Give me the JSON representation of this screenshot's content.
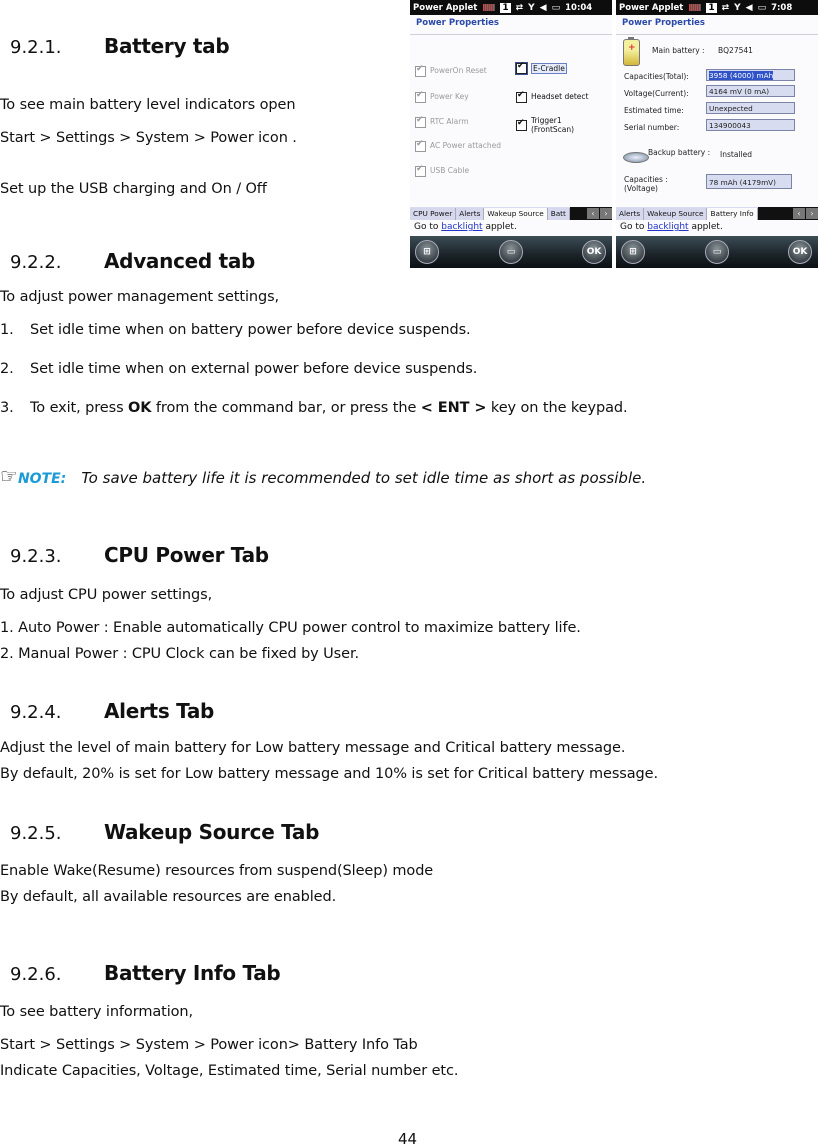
{
  "page_number": "44",
  "sections": [
    {
      "number": "9.2.1.",
      "title": "Battery tab",
      "lines": [
        "To see main battery level indicators open",
        "Start > Settings > System > Power icon .",
        "Set up the USB charging and On / Off"
      ]
    },
    {
      "number": "9.2.2.",
      "title": "Advanced tab",
      "intro": "To adjust power management settings,",
      "items": [
        "1.",
        "Set idle time when on battery power before device suspends.",
        "2.",
        "Set idle time when on external power before device suspends.",
        "3."
      ],
      "step3": {
        "pre": "To exit, press ",
        "ok": "OK",
        "mid": " from the command bar, or press the ",
        "ent": "< ENT >",
        "post": " key on the keypad."
      },
      "note": {
        "icon": "☞",
        "label": "NOTE:",
        "text": "To save battery life it is recommended to set idle time as short as possible."
      }
    },
    {
      "number": "9.2.3.",
      "title": "CPU Power Tab",
      "lines": [
        "To adjust CPU power settings,",
        "1. Auto Power : Enable automatically CPU power control to maximize battery life.",
        "2. Manual Power : CPU Clock can be fixed by User."
      ]
    },
    {
      "number": "9.2.4.",
      "title": "Alerts Tab",
      "lines": [
        "Adjust the level of main battery for Low battery message and Critical battery message.",
        "By default, 20%  is set for Low battery message and 10%  is set for Critical battery message."
      ]
    },
    {
      "number": "9.2.5.",
      "title": "Wakeup Source Tab",
      "lines": [
        "Enable Wake(Resume) resources from suspend(Sleep) mode",
        "By default, all available resources are enabled."
      ]
    },
    {
      "number": "9.2.6.",
      "title": "Battery Info Tab",
      "lines": [
        "To see battery information,",
        "Start > Settings > System > Power icon> Battery Info Tab",
        "Indicate Capacities, Voltage, Estimated time, Serial number etc."
      ]
    }
  ],
  "screens": [
    {
      "status": {
        "app": "Power Applet",
        "one": "1",
        "time": "10:04"
      },
      "header": "Power Properties",
      "checkboxes_left": [
        {
          "label": "PowerOn Reset",
          "checked": true,
          "enabled": false
        },
        {
          "label": "Power Key",
          "checked": true,
          "enabled": false
        },
        {
          "label": "RTC Alarm",
          "checked": true,
          "enabled": false
        },
        {
          "label": "AC Power attached",
          "checked": true,
          "enabled": false
        },
        {
          "label": "USB Cable",
          "checked": true,
          "enabled": false
        }
      ],
      "checkboxes_right": [
        {
          "label": "E-Cradle",
          "checked": true,
          "enabled": true
        },
        {
          "label": "Headset detect",
          "checked": true,
          "enabled": true
        },
        {
          "label": "Trigger1",
          "label2": "(FrontScan)",
          "checked": true,
          "enabled": true
        }
      ],
      "tabs": [
        "CPU Power",
        "Alerts",
        "Wakeup Source",
        "Batt"
      ],
      "active_tab": "Wakeup Source",
      "goto": {
        "pre": "Go to ",
        "link": "backlight",
        "post": " applet."
      },
      "softkeys": {
        "right": "OK"
      }
    },
    {
      "status": {
        "app": "Power Applet",
        "one": "1",
        "time": "7:08"
      },
      "header": "Power Properties",
      "main_battery": {
        "label": "Main battery :",
        "value": "BQ27541"
      },
      "fields": [
        {
          "label": "Capacities(Total):",
          "value": "3958 (4000) mAh"
        },
        {
          "label": "Voltage(Current):",
          "value": "4164 mV (0 mA)"
        },
        {
          "label": "Estimated time:",
          "value": "Unexpected"
        },
        {
          "label": "Serial number:",
          "value": "134900043"
        }
      ],
      "backup_battery": {
        "label": "Backup battery :",
        "value": "Installed"
      },
      "backup_capacity": {
        "label": "Capacities :",
        "label2": "(Voltage)",
        "value": "78 mAh (4179mV)"
      },
      "tabs": [
        "Alerts",
        "Wakeup Source",
        "Battery Info"
      ],
      "active_tab": "Battery Info",
      "goto": {
        "pre": "Go to ",
        "link": "backlight",
        "post": " applet."
      },
      "softkeys": {
        "right": "OK"
      }
    }
  ]
}
